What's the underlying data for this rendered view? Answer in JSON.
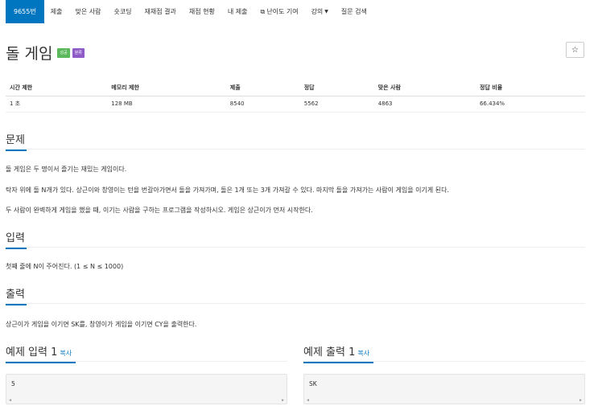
{
  "nav": {
    "tabs": [
      "9655번",
      "제출",
      "맞은 사람",
      "숏코딩",
      "재채점 결과",
      "채점 현황",
      "내 제출",
      "난이도 기여",
      "강의",
      "질문 검색"
    ]
  },
  "problem": {
    "title": "돌 게임",
    "badges": [
      "성공",
      "분류"
    ],
    "star": "☆"
  },
  "info_table": {
    "headers": [
      "시간 제한",
      "메모리 제한",
      "제출",
      "정답",
      "맞은 사람",
      "정답 비율"
    ],
    "values": [
      "1 초",
      "128 MB",
      "8540",
      "5562",
      "4863",
      "66.434%"
    ]
  },
  "sections": {
    "problem_heading": "문제",
    "problem_lines": [
      "돌 게임은 두 명이서 즐기는 재밌는 게임이다.",
      "탁자 위에 돌 N개가 있다. 상근이와 창영이는 턴을 번갈아가면서 돌을 가져가며, 돌은 1개 또는 3개 가져갈 수 있다. 마지막 돌을 가져가는 사람이 게임을 이기게 된다.",
      "두 사람이 완벽하게 게임을 했을 때, 이기는 사람을 구하는 프로그램을 작성하시오. 게임은 상근이가 먼저 시작한다."
    ],
    "input_heading": "입력",
    "input_text": "첫째 줄에 N이 주어진다. (1 ≤ N ≤ 1000)",
    "output_heading": "출력",
    "output_text": "상근이가 게임을 이기면 SK를, 창영이가 게임을 이기면 CY을 출력한다."
  },
  "examples": {
    "input_heading": "예제 입력 1",
    "output_heading": "예제 출력 1",
    "copy_label": "복사",
    "input_value": "5",
    "output_value": "SK"
  }
}
